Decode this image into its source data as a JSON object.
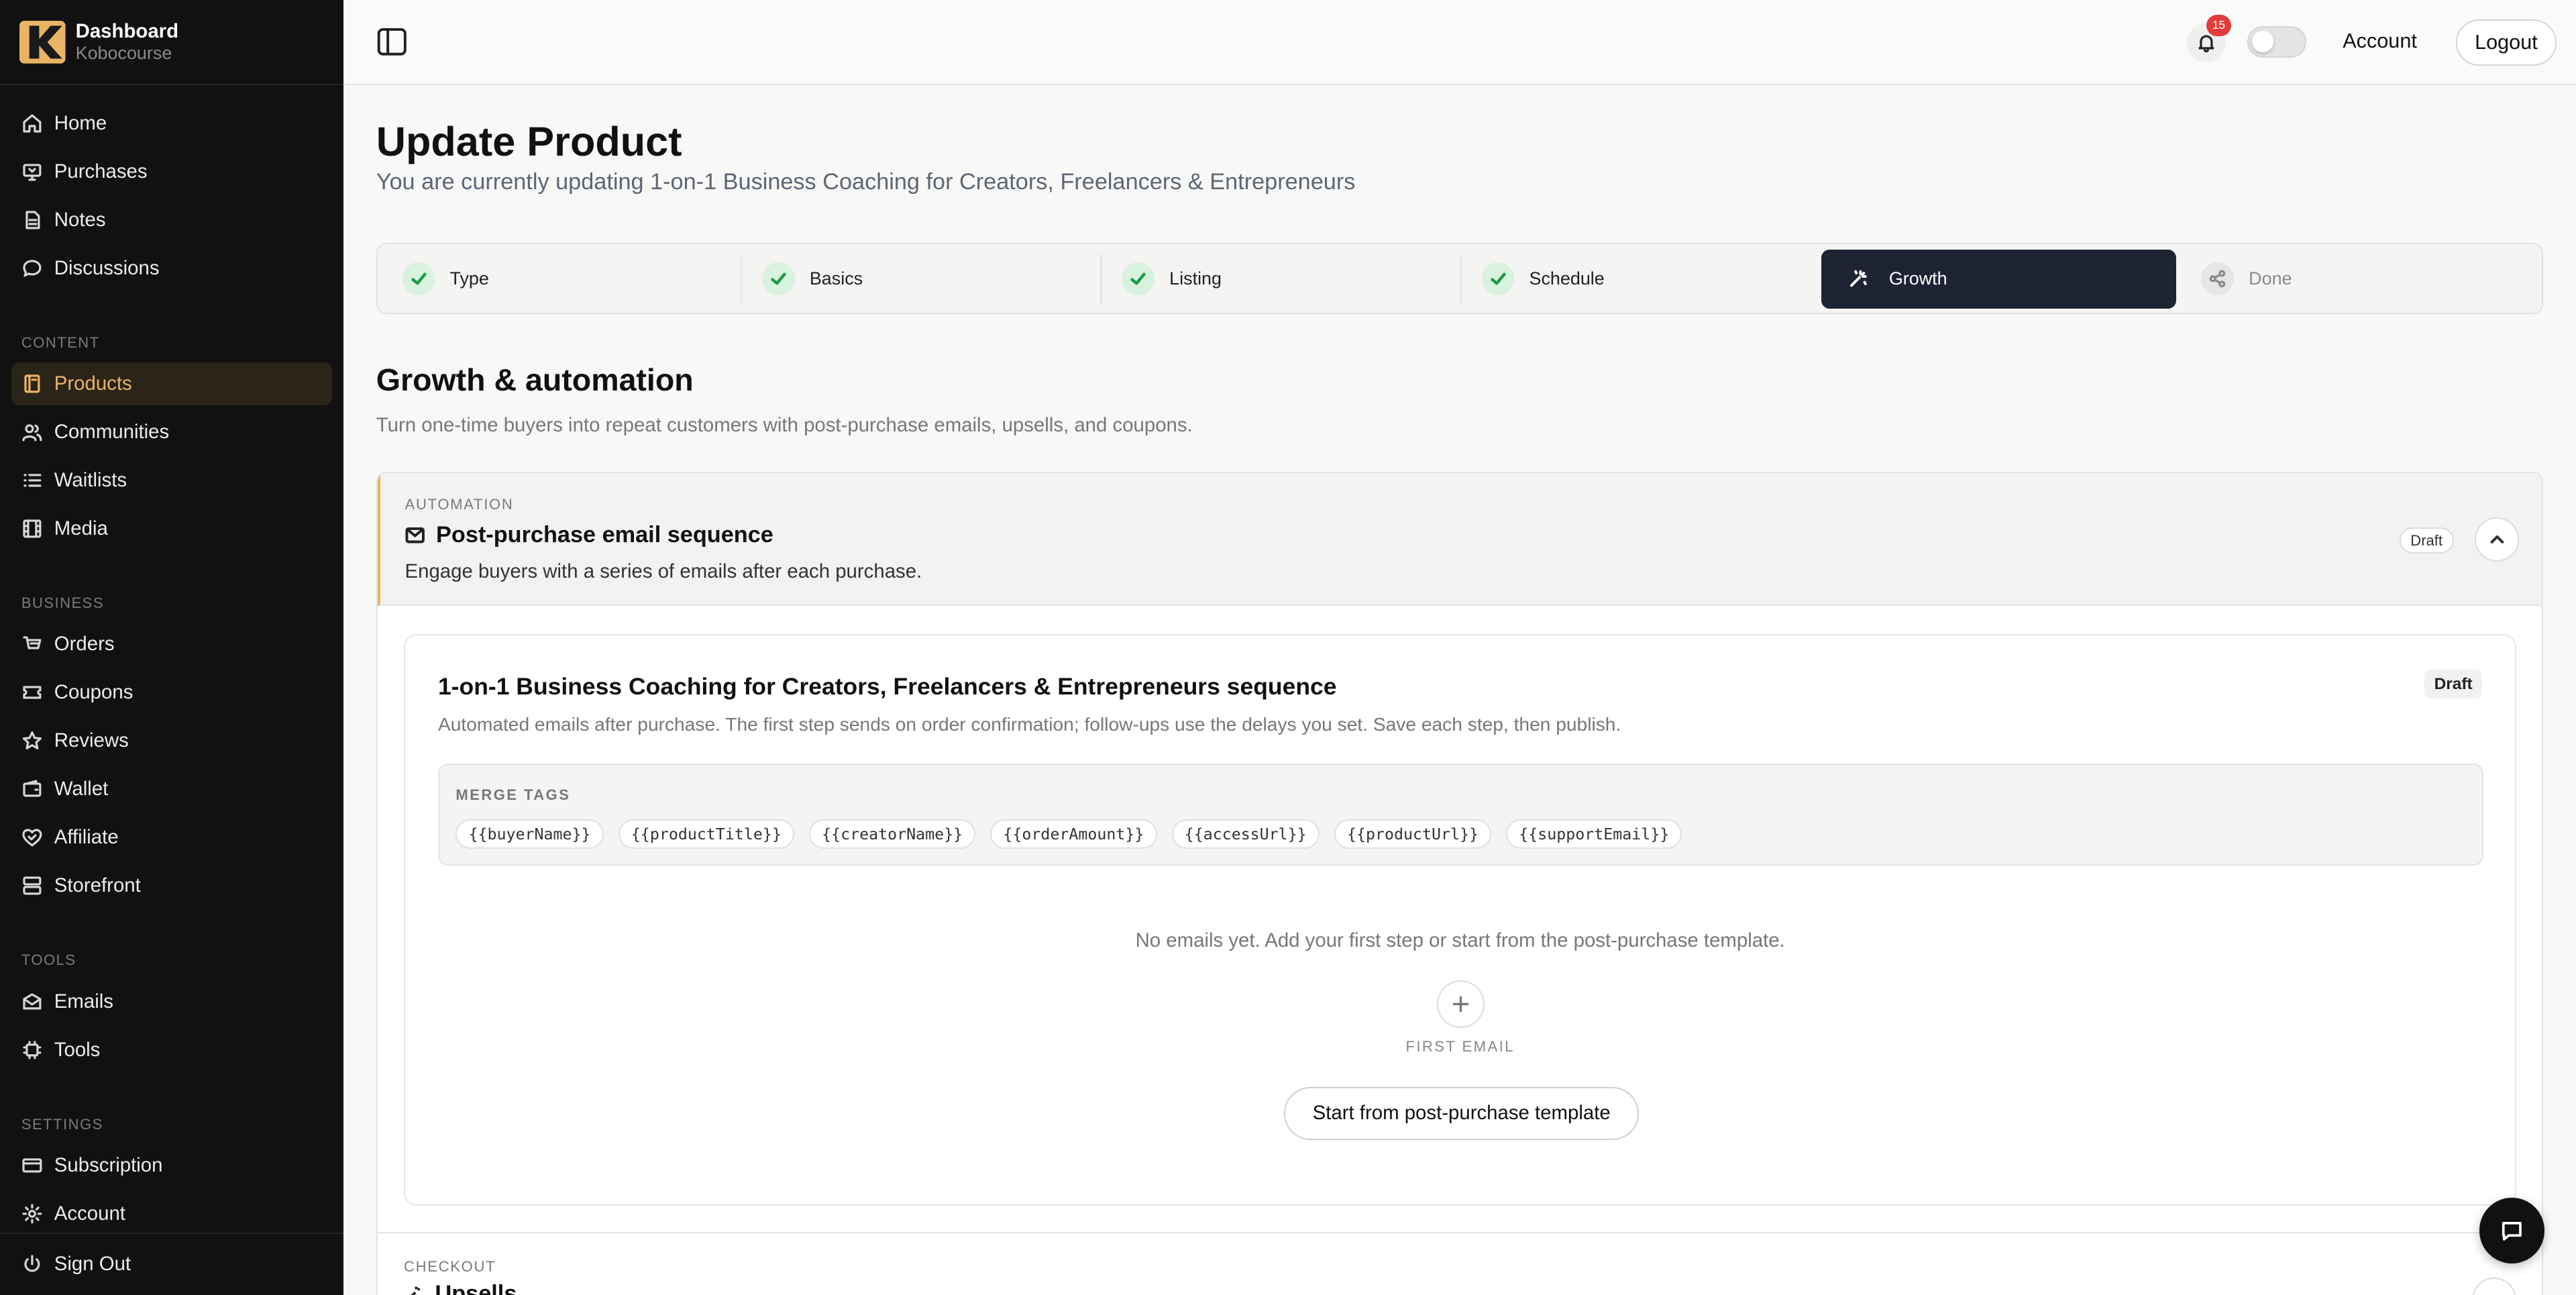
{
  "brand": {
    "title": "Dashboard",
    "subtitle": "Kobocourse"
  },
  "sidebar": {
    "items_top": [
      {
        "label": "Home",
        "icon": "home-icon"
      },
      {
        "label": "Purchases",
        "icon": "purchases-icon"
      },
      {
        "label": "Notes",
        "icon": "notes-icon"
      },
      {
        "label": "Discussions",
        "icon": "chat-bubble-icon"
      }
    ],
    "groups": {
      "content": "CONTENT",
      "business": "BUSINESS",
      "tools": "TOOLS",
      "settings": "SETTINGS"
    },
    "content_items": [
      {
        "label": "Products",
        "icon": "book-icon",
        "active": true
      },
      {
        "label": "Communities",
        "icon": "users-icon"
      },
      {
        "label": "Waitlists",
        "icon": "list-icon"
      },
      {
        "label": "Media",
        "icon": "film-icon"
      }
    ],
    "business_items": [
      {
        "label": "Orders",
        "icon": "orders-icon"
      },
      {
        "label": "Coupons",
        "icon": "ticket-icon"
      },
      {
        "label": "Reviews",
        "icon": "star-icon"
      },
      {
        "label": "Wallet",
        "icon": "wallet-icon"
      },
      {
        "label": "Affiliate",
        "icon": "handshake-icon"
      },
      {
        "label": "Storefront",
        "icon": "storefront-icon"
      }
    ],
    "tools_items": [
      {
        "label": "Emails",
        "icon": "mail-icon"
      },
      {
        "label": "Tools",
        "icon": "tools-icon"
      }
    ],
    "settings_items": [
      {
        "label": "Subscription",
        "icon": "credit-card-icon"
      },
      {
        "label": "Account",
        "icon": "gear-icon"
      }
    ],
    "signout": "Sign Out"
  },
  "topbar": {
    "notification_count": "15",
    "account": "Account",
    "logout": "Logout"
  },
  "page": {
    "title": "Update Product",
    "subtitle": "You are currently updating 1-on-1 Business Coaching for Creators, Freelancers & Entrepreneurs"
  },
  "steps": [
    {
      "label": "Type",
      "state": "done"
    },
    {
      "label": "Basics",
      "state": "done"
    },
    {
      "label": "Listing",
      "state": "done"
    },
    {
      "label": "Schedule",
      "state": "done"
    },
    {
      "label": "Growth",
      "state": "active"
    },
    {
      "label": "Done",
      "state": "pending"
    }
  ],
  "growth": {
    "title": "Growth & automation",
    "subtitle": "Turn one-time buyers into repeat customers with post-purchase emails, upsells, and coupons."
  },
  "automation": {
    "eyebrow": "AUTOMATION",
    "title": "Post-purchase email sequence",
    "description": "Engage buyers with a series of emails after each purchase.",
    "status": "Draft"
  },
  "sequence": {
    "title": "1-on-1 Business Coaching for Creators, Freelancers & Entrepreneurs sequence",
    "status": "Draft",
    "description": "Automated emails after purchase. The first step sends on order confirmation; follow-ups use the delays you set. Save each step, then publish.",
    "merge_label": "MERGE TAGS",
    "merge_tags": [
      "{{buyerName}}",
      "{{productTitle}}",
      "{{creatorName}}",
      "{{orderAmount}}",
      "{{accessUrl}}",
      "{{productUrl}}",
      "{{supportEmail}}"
    ],
    "empty_text": "No emails yet. Add your first step or start from the post-purchase template.",
    "first_email_label": "FIRST EMAIL",
    "template_button": "Start from post-purchase template"
  },
  "checkout": {
    "eyebrow": "CHECKOUT",
    "title": "Upsells"
  },
  "colors": {
    "sidebar_bg": "#111111",
    "accent": "#e9b463",
    "active_step_bg": "#1e2433",
    "check_green": "#1e9a4c",
    "badge_red": "#e23b3b"
  }
}
